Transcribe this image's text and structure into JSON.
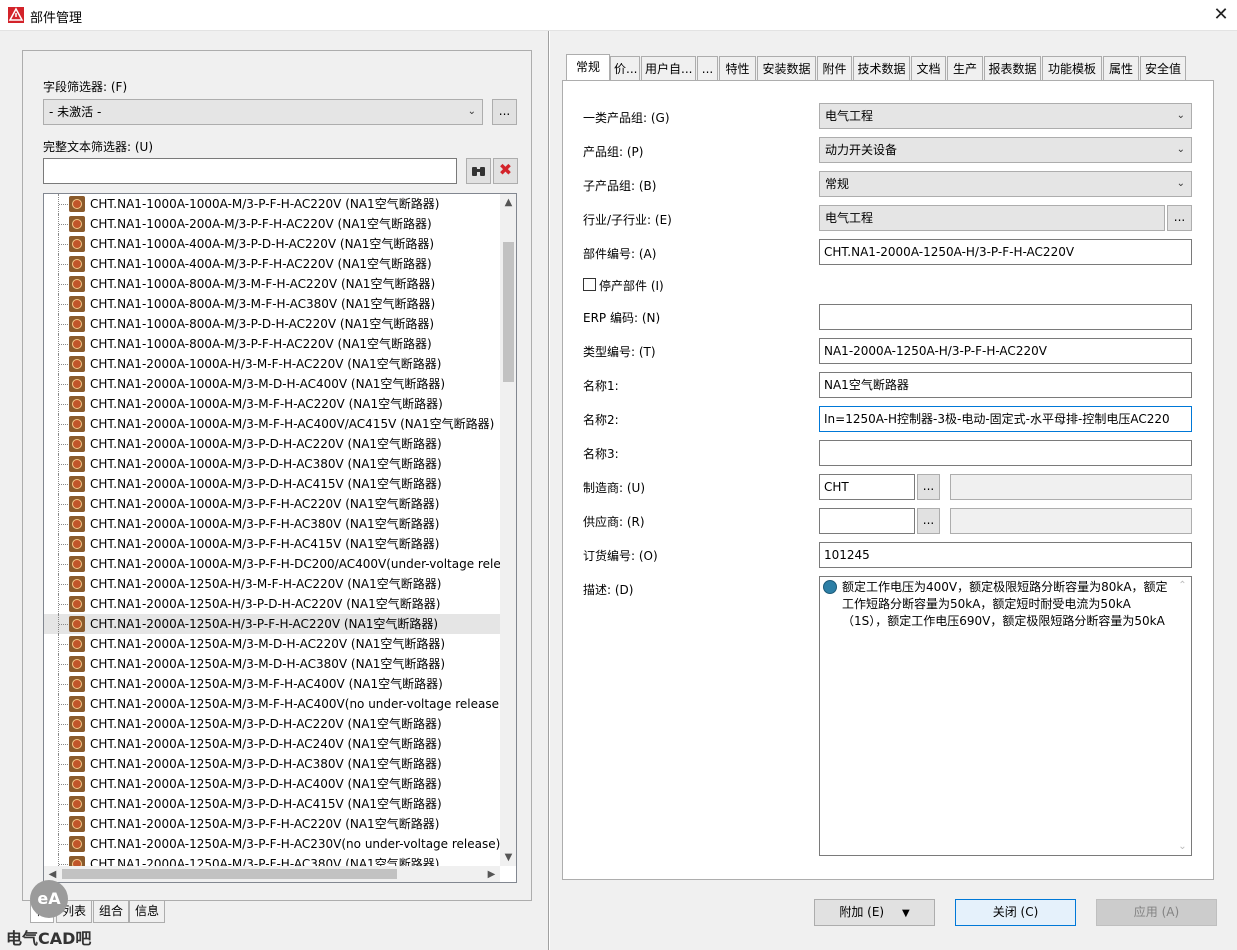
{
  "window": {
    "title": "部件管理",
    "close_glyph": "✕"
  },
  "left": {
    "field_filter_label": "字段筛选器: (F)",
    "field_filter_value": "- 未激活 -",
    "field_filter_more": "...",
    "text_filter_label": "完整文本筛选器: (U)",
    "text_filter_value": "",
    "tree_items": [
      "CHT.NA1-1000A-1000A-M/3-P-F-H-AC220V (NA1空气断路器)",
      "CHT.NA1-1000A-200A-M/3-P-F-H-AC220V (NA1空气断路器)",
      "CHT.NA1-1000A-400A-M/3-P-D-H-AC220V (NA1空气断路器)",
      "CHT.NA1-1000A-400A-M/3-P-F-H-AC220V (NA1空气断路器)",
      "CHT.NA1-1000A-800A-M/3-M-F-H-AC220V (NA1空气断路器)",
      "CHT.NA1-1000A-800A-M/3-M-F-H-AC380V (NA1空气断路器)",
      "CHT.NA1-1000A-800A-M/3-P-D-H-AC220V (NA1空气断路器)",
      "CHT.NA1-1000A-800A-M/3-P-F-H-AC220V (NA1空气断路器)",
      "CHT.NA1-2000A-1000A-H/3-M-F-H-AC220V (NA1空气断路器)",
      "CHT.NA1-2000A-1000A-M/3-M-D-H-AC400V (NA1空气断路器)",
      "CHT.NA1-2000A-1000A-M/3-M-F-H-AC220V (NA1空气断路器)",
      "CHT.NA1-2000A-1000A-M/3-M-F-H-AC400V/AC415V (NA1空气断路器)",
      "CHT.NA1-2000A-1000A-M/3-P-D-H-AC220V (NA1空气断路器)",
      "CHT.NA1-2000A-1000A-M/3-P-D-H-AC380V (NA1空气断路器)",
      "CHT.NA1-2000A-1000A-M/3-P-D-H-AC415V (NA1空气断路器)",
      "CHT.NA1-2000A-1000A-M/3-P-F-H-AC220V (NA1空气断路器)",
      "CHT.NA1-2000A-1000A-M/3-P-F-H-AC380V (NA1空气断路器)",
      "CHT.NA1-2000A-1000A-M/3-P-F-H-AC415V (NA1空气断路器)",
      "CHT.NA1-2000A-1000A-M/3-P-F-H-DC200/AC400V(under-voltage relea",
      "CHT.NA1-2000A-1250A-H/3-M-F-H-AC220V (NA1空气断路器)",
      "CHT.NA1-2000A-1250A-H/3-P-D-H-AC220V (NA1空气断路器)",
      "CHT.NA1-2000A-1250A-H/3-P-F-H-AC220V (NA1空气断路器)",
      "CHT.NA1-2000A-1250A-M/3-M-D-H-AC220V (NA1空气断路器)",
      "CHT.NA1-2000A-1250A-M/3-M-D-H-AC380V (NA1空气断路器)",
      "CHT.NA1-2000A-1250A-M/3-M-F-H-AC400V (NA1空气断路器)",
      "CHT.NA1-2000A-1250A-M/3-M-F-H-AC400V(no under-voltage release)",
      "CHT.NA1-2000A-1250A-M/3-P-D-H-AC220V (NA1空气断路器)",
      "CHT.NA1-2000A-1250A-M/3-P-D-H-AC240V (NA1空气断路器)",
      "CHT.NA1-2000A-1250A-M/3-P-D-H-AC380V (NA1空气断路器)",
      "CHT.NA1-2000A-1250A-M/3-P-D-H-AC400V (NA1空气断路器)",
      "CHT.NA1-2000A-1250A-M/3-P-D-H-AC415V (NA1空气断路器)",
      "CHT.NA1-2000A-1250A-M/3-P-F-H-AC220V (NA1空气断路器)",
      "CHT.NA1-2000A-1250A-M/3-P-F-H-AC230V(no under-voltage release)",
      "CHT.NA1-2000A-1250A-M/3-P-F-H-AC380V (NA1空气断路器)"
    ],
    "selected_index": 21,
    "bottom_tabs": [
      "树",
      "列表",
      "组合",
      "信息"
    ]
  },
  "tabs": [
    "常规",
    "价...",
    "用户自...",
    "...",
    "特性",
    "安装数据",
    "附件",
    "技术数据",
    "文档",
    "生产",
    "报表数据",
    "功能模板",
    "属性",
    "安全值"
  ],
  "form": {
    "product_group1_label": "一类产品组: (G)",
    "product_group1_value": "电气工程",
    "product_group_label": "产品组: (P)",
    "product_group_value": "动力开关设备",
    "sub_group_label": "子产品组: (B)",
    "sub_group_value": "常规",
    "industry_label": "行业/子行业: (E)",
    "industry_value": "电气工程",
    "part_number_label": "部件编号: (A)",
    "part_number_value": "CHT.NA1-2000A-1250A-H/3-P-F-H-AC220V",
    "discontinued_label": "停产部件 (I)",
    "erp_label": "ERP 编码: (N)",
    "erp_value": "",
    "type_label": "类型编号: (T)",
    "type_value": "NA1-2000A-1250A-H/3-P-F-H-AC220V",
    "name1_label": "名称1:",
    "name1_value": "NA1空气断路器",
    "name2_label": "名称2:",
    "name2_value": "In=1250A-H控制器-3极-电动-固定式-水平母排-控制电压AC220",
    "name3_label": "名称3:",
    "name3_value": "",
    "manufacturer_label": "制造商: (U)",
    "manufacturer_value": "CHT",
    "supplier_label": "供应商: (R)",
    "supplier_value": "",
    "order_no_label": "订货编号: (O)",
    "order_no_value": "101245",
    "desc_label": "描述: (D)",
    "desc_value": "额定工作电压为400V，额定极限短路分断容量为80kA，额定工作短路分断容量为50kA，额定短时耐受电流为50kA（1S），额定工作电压690V，额定极限短路分断容量为50kA",
    "more": "..."
  },
  "buttons": {
    "add": "附加 (E)",
    "add_arrow": "▼",
    "close": "关闭 (C)",
    "apply": "应用 (A)"
  },
  "watermark": {
    "logo": "eA",
    "text": "电气CAD吧"
  }
}
